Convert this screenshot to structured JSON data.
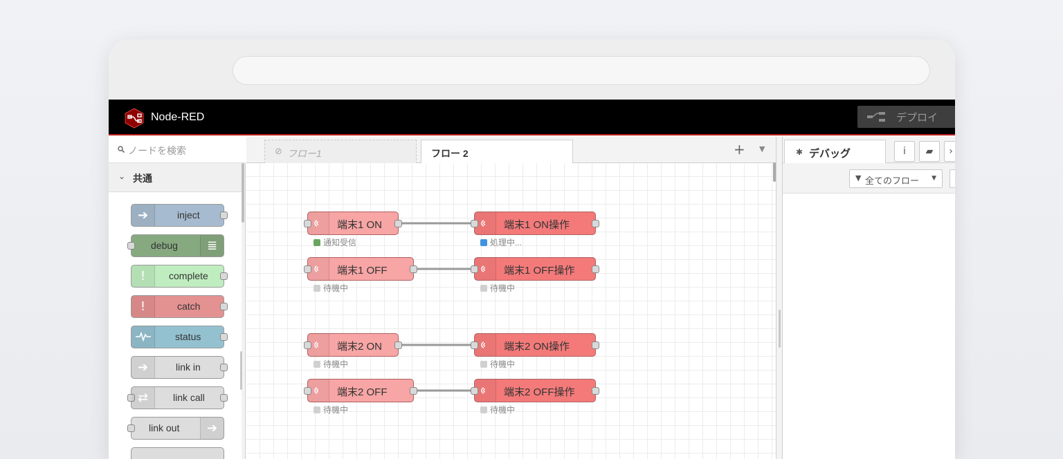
{
  "app": {
    "title": "Node-RED",
    "deploy_label": "デプロイ"
  },
  "palette": {
    "search_placeholder": "ノードを検索",
    "category": "共通",
    "nodes": [
      {
        "label": "inject",
        "color": "#a6bbcf"
      },
      {
        "label": "debug",
        "color": "#87a980"
      },
      {
        "label": "complete",
        "color": "#c0edc0"
      },
      {
        "label": "catch",
        "color": "#e49191"
      },
      {
        "label": "status",
        "color": "#94c1d0"
      },
      {
        "label": "link in",
        "color": "#dddddd"
      },
      {
        "label": "link call",
        "color": "#dddddd"
      },
      {
        "label": "link out",
        "color": "#dddddd"
      }
    ]
  },
  "workspace": {
    "tabs": [
      {
        "label": "フロー1",
        "disabled": true
      },
      {
        "label": "フロー 2",
        "active": true
      }
    ],
    "nodes": [
      {
        "label": "端末1 ON",
        "status": "通知受信",
        "status_color": "#6aa55f"
      },
      {
        "label": "端末1 ON操作",
        "status": "処理中...",
        "status_color": "#3f93e0"
      },
      {
        "label": "端末1 OFF",
        "status": "待機中",
        "status_color": "#d0d0d0"
      },
      {
        "label": "端末1 OFF操作",
        "status": "待機中",
        "status_color": "#d0d0d0"
      },
      {
        "label": "端末2 ON",
        "status": "待機中",
        "status_color": "#d0d0d0"
      },
      {
        "label": "端末2 ON操作",
        "status": "待機中",
        "status_color": "#d0d0d0"
      },
      {
        "label": "端末2 OFF",
        "status": "待機中",
        "status_color": "#d0d0d0"
      },
      {
        "label": "端末2 OFF操作",
        "status": "待機中",
        "status_color": "#d0d0d0"
      }
    ]
  },
  "sidebar": {
    "tab_label": "デバッグ",
    "filter_label": "全てのフロー"
  },
  "colors": {
    "header_bg": "#000000",
    "header_accent": "#c02020",
    "input_node": "#f7a5a5",
    "output_node": "#f47a7a"
  }
}
